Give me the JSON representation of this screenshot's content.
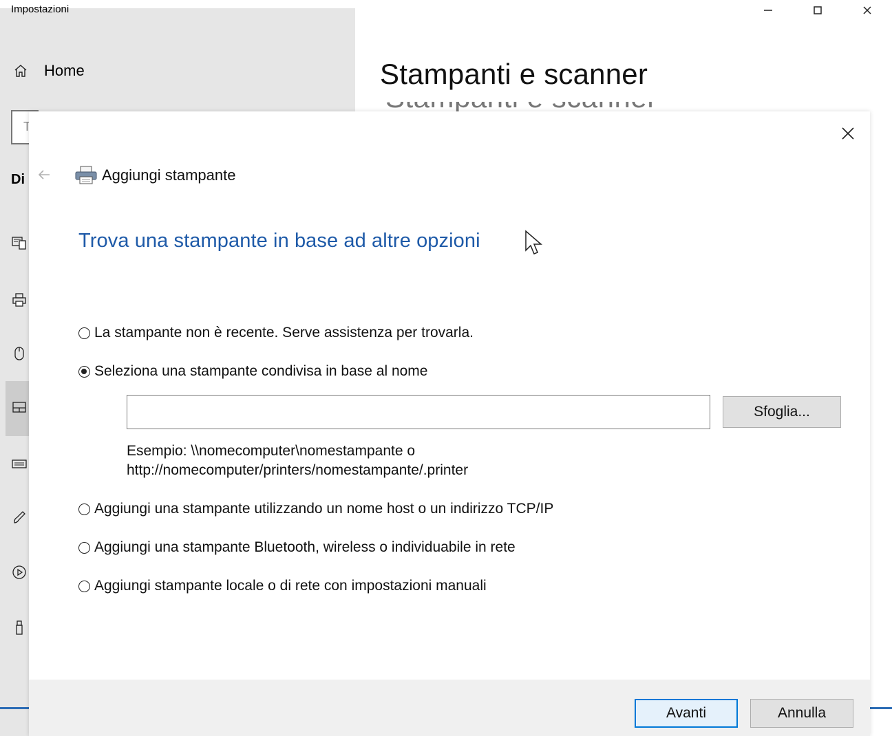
{
  "settings": {
    "title": "Impostazioni",
    "home_label": "Home",
    "page_heading": "Stampanti e scanner",
    "search_stub": "T",
    "group_stub": "Di",
    "window_controls": [
      "minimize",
      "maximize",
      "close"
    ],
    "side_icons": [
      "keyboard-icon",
      "printer-icon",
      "mouse-icon",
      "touchpad-icon",
      "keyboard-icon",
      "pen-icon",
      "autoplay-icon",
      "usb-icon"
    ]
  },
  "dialog": {
    "title": "Aggiungi stampante",
    "instruction": "Trova una stampante in base ad altre opzioni",
    "options": [
      {
        "label": "La stampante non è recente. Serve assistenza per trovarla.",
        "checked": false
      },
      {
        "label": "Seleziona una stampante condivisa in base al nome",
        "checked": true
      },
      {
        "label": "Aggiungi una stampante utilizzando un nome host o un indirizzo TCP/IP",
        "checked": false
      },
      {
        "label": "Aggiungi una stampante Bluetooth, wireless o individuabile in rete",
        "checked": false
      },
      {
        "label": "Aggiungi stampante locale o di rete con impostazioni manuali",
        "checked": false
      }
    ],
    "shared_name_value": "",
    "browse_label": "Sfoglia...",
    "example_line1": "Esempio: \\\\nomecomputer\\nomestampante o",
    "example_line2": "http://nomecomputer/printers/nomestampante/.printer",
    "next_label": "Avanti",
    "cancel_label": "Annulla"
  }
}
